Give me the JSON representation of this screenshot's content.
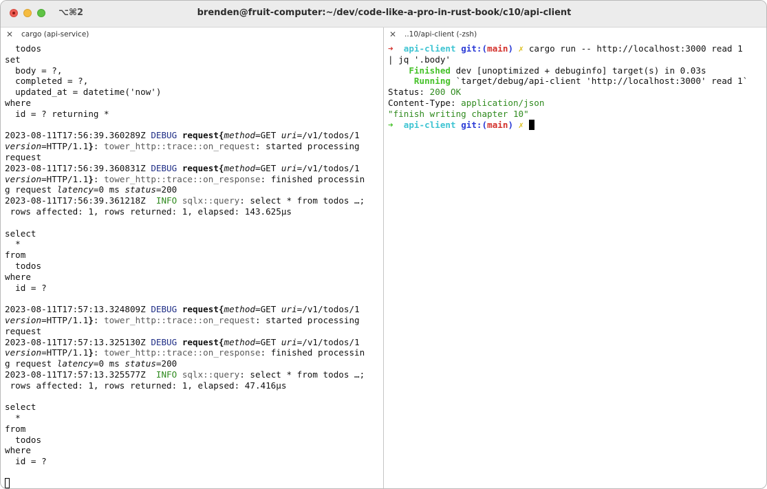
{
  "window": {
    "shortcut": "⌥⌘2",
    "title": "brenden@fruit-computer:~/dev/code-like-a-pro-in-rust-book/c10/api-client"
  },
  "tabs": [
    {
      "title": "cargo (api-service)",
      "close_glyph": "✕"
    },
    {
      "title": "..10/api-client (-zsh)",
      "close_glyph": "✕"
    }
  ],
  "left_lines": [
    [
      {
        "t": "  todos"
      }
    ],
    [
      {
        "t": "set"
      }
    ],
    [
      {
        "t": "  body = ?,"
      }
    ],
    [
      {
        "t": "  completed = ?,"
      }
    ],
    [
      {
        "t": "  updated_at = datetime('now')"
      }
    ],
    [
      {
        "t": "where"
      }
    ],
    [
      {
        "t": "  id = ? returning *"
      }
    ],
    [
      {
        "t": ""
      }
    ],
    [
      {
        "t": "2023-08-11T17:56:39.360289Z "
      },
      {
        "t": "DEBUG",
        "c": "navy"
      },
      {
        "t": " "
      },
      {
        "t": "request{",
        "c": "bold"
      },
      {
        "t": "method",
        "c": "it"
      },
      {
        "t": "=GET "
      },
      {
        "t": "uri",
        "c": "it"
      },
      {
        "t": "=/v1/todos/1"
      }
    ],
    [
      {
        "t": "version",
        "c": "it"
      },
      {
        "t": "=HTTP/1.1"
      },
      {
        "t": "}",
        "c": "bold"
      },
      {
        "t": ": "
      },
      {
        "t": "tower_http::trace::on_request",
        "c": "gray"
      },
      {
        "t": ": started processing"
      }
    ],
    [
      {
        "t": "request"
      }
    ],
    [
      {
        "t": "2023-08-11T17:56:39.360831Z "
      },
      {
        "t": "DEBUG",
        "c": "navy"
      },
      {
        "t": " "
      },
      {
        "t": "request{",
        "c": "bold"
      },
      {
        "t": "method",
        "c": "it"
      },
      {
        "t": "=GET "
      },
      {
        "t": "uri",
        "c": "it"
      },
      {
        "t": "=/v1/todos/1"
      }
    ],
    [
      {
        "t": "version",
        "c": "it"
      },
      {
        "t": "=HTTP/1.1"
      },
      {
        "t": "}",
        "c": "bold"
      },
      {
        "t": ": "
      },
      {
        "t": "tower_http::trace::on_response",
        "c": "gray"
      },
      {
        "t": ": finished processin"
      }
    ],
    [
      {
        "t": "g request "
      },
      {
        "t": "latency",
        "c": "it"
      },
      {
        "t": "=0 ms "
      },
      {
        "t": "status",
        "c": "it"
      },
      {
        "t": "=200"
      }
    ],
    [
      {
        "t": "2023-08-11T17:56:39.361218Z  "
      },
      {
        "t": "INFO",
        "c": "green"
      },
      {
        "t": " "
      },
      {
        "t": "sqlx::query",
        "c": "gray"
      },
      {
        "t": ": select * from todos …;"
      }
    ],
    [
      {
        "t": " rows affected: 1, rows returned: 1, elapsed: 143.625µs"
      }
    ],
    [
      {
        "t": ""
      }
    ],
    [
      {
        "t": "select"
      }
    ],
    [
      {
        "t": "  *"
      }
    ],
    [
      {
        "t": "from"
      }
    ],
    [
      {
        "t": "  todos"
      }
    ],
    [
      {
        "t": "where"
      }
    ],
    [
      {
        "t": "  id = ?"
      }
    ],
    [
      {
        "t": ""
      }
    ],
    [
      {
        "t": "2023-08-11T17:57:13.324809Z "
      },
      {
        "t": "DEBUG",
        "c": "navy"
      },
      {
        "t": " "
      },
      {
        "t": "request{",
        "c": "bold"
      },
      {
        "t": "method",
        "c": "it"
      },
      {
        "t": "=GET "
      },
      {
        "t": "uri",
        "c": "it"
      },
      {
        "t": "=/v1/todos/1"
      }
    ],
    [
      {
        "t": "version",
        "c": "it"
      },
      {
        "t": "=HTTP/1.1"
      },
      {
        "t": "}",
        "c": "bold"
      },
      {
        "t": ": "
      },
      {
        "t": "tower_http::trace::on_request",
        "c": "gray"
      },
      {
        "t": ": started processing"
      }
    ],
    [
      {
        "t": "request"
      }
    ],
    [
      {
        "t": "2023-08-11T17:57:13.325130Z "
      },
      {
        "t": "DEBUG",
        "c": "navy"
      },
      {
        "t": " "
      },
      {
        "t": "request{",
        "c": "bold"
      },
      {
        "t": "method",
        "c": "it"
      },
      {
        "t": "=GET "
      },
      {
        "t": "uri",
        "c": "it"
      },
      {
        "t": "=/v1/todos/1"
      }
    ],
    [
      {
        "t": "version",
        "c": "it"
      },
      {
        "t": "=HTTP/1.1"
      },
      {
        "t": "}",
        "c": "bold"
      },
      {
        "t": ": "
      },
      {
        "t": "tower_http::trace::on_response",
        "c": "gray"
      },
      {
        "t": ": finished processin"
      }
    ],
    [
      {
        "t": "g request "
      },
      {
        "t": "latency",
        "c": "it"
      },
      {
        "t": "=0 ms "
      },
      {
        "t": "status",
        "c": "it"
      },
      {
        "t": "=200"
      }
    ],
    [
      {
        "t": "2023-08-11T17:57:13.325577Z  "
      },
      {
        "t": "INFO",
        "c": "green"
      },
      {
        "t": " "
      },
      {
        "t": "sqlx::query",
        "c": "gray"
      },
      {
        "t": ": select * from todos …;"
      }
    ],
    [
      {
        "t": " rows affected: 1, rows returned: 1, elapsed: 47.416µs"
      }
    ],
    [
      {
        "t": ""
      }
    ],
    [
      {
        "t": "select"
      }
    ],
    [
      {
        "t": "  *"
      }
    ],
    [
      {
        "t": "from"
      }
    ],
    [
      {
        "t": "  todos"
      }
    ],
    [
      {
        "t": "where"
      }
    ],
    [
      {
        "t": "  id = ?"
      }
    ],
    [
      {
        "t": ""
      }
    ],
    [
      {
        "t": "",
        "cursor": "hollow"
      }
    ]
  ],
  "right_lines": [
    [
      {
        "t": "➜",
        "c": "red"
      },
      {
        "t": "  "
      },
      {
        "t": "api-client",
        "c": "cyan"
      },
      {
        "t": " "
      },
      {
        "t": "git:(",
        "c": "blue"
      },
      {
        "t": "main",
        "c": "red"
      },
      {
        "t": ")",
        "c": "blue"
      },
      {
        "t": " "
      },
      {
        "t": "✗",
        "c": "yellow"
      },
      {
        "t": " cargo run -- http://localhost:3000 read 1"
      }
    ],
    [
      {
        "t": "| jq '.body'"
      }
    ],
    [
      {
        "t": "    "
      },
      {
        "t": "Finished",
        "c": "brgreen"
      },
      {
        "t": " dev [unoptimized + debuginfo] target(s) in 0.03s"
      }
    ],
    [
      {
        "t": "     "
      },
      {
        "t": "Running",
        "c": "brgreen"
      },
      {
        "t": " `target/debug/api-client 'http://localhost:3000' read 1`"
      }
    ],
    [
      {
        "t": "Status: "
      },
      {
        "t": "200 OK",
        "c": "green"
      }
    ],
    [
      {
        "t": "Content-Type: "
      },
      {
        "t": "application/json",
        "c": "green"
      }
    ],
    [
      {
        "t": "\"finish writing chapter 10\"",
        "c": "green"
      }
    ],
    [
      {
        "t": "➜",
        "c": "brgreen"
      },
      {
        "t": "  "
      },
      {
        "t": "api-client",
        "c": "cyan"
      },
      {
        "t": " "
      },
      {
        "t": "git:(",
        "c": "blue"
      },
      {
        "t": "main",
        "c": "red"
      },
      {
        "t": ")",
        "c": "blue"
      },
      {
        "t": " "
      },
      {
        "t": "✗",
        "c": "yellow"
      },
      {
        "t": " ",
        "cursor": "block"
      }
    ]
  ]
}
